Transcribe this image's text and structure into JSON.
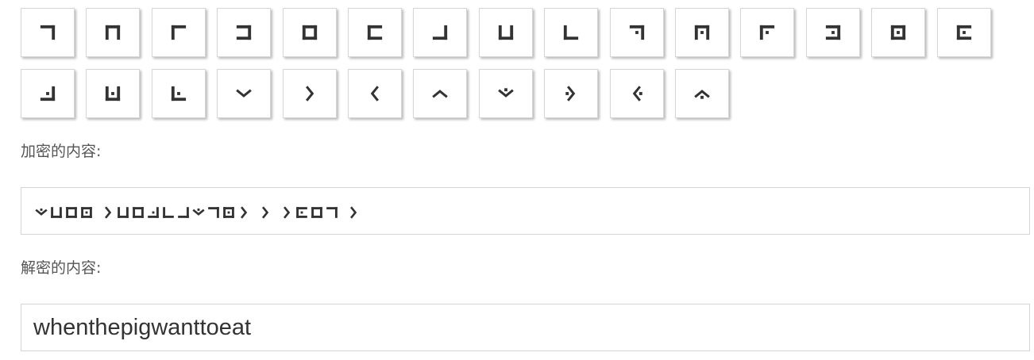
{
  "colors": {
    "glyph": "#333333",
    "key_border": "#d6d6d6",
    "field_border": "#d4d4d4",
    "label": "#555555"
  },
  "keypad": {
    "row1": [
      "a",
      "b",
      "c",
      "d",
      "e",
      "f",
      "g",
      "h",
      "i",
      "j",
      "k",
      "l",
      "m",
      "n",
      "o"
    ],
    "row2": [
      "p",
      "q",
      "r",
      "s",
      "t",
      "u",
      "v",
      "w",
      "x",
      "y",
      "z"
    ]
  },
  "encrypted_label": "加密的内容:",
  "encrypted_glyphs": [
    "w",
    "h",
    "e",
    "n",
    " ",
    "t",
    "h",
    "e",
    "p",
    "i",
    "g",
    "w",
    "a",
    "n",
    "t",
    " ",
    "t",
    " ",
    "t",
    "o",
    "e",
    "a",
    " ",
    "t"
  ],
  "decrypted_label": "解密的内容:",
  "decrypted_value": "whenthepigwanttoeat"
}
